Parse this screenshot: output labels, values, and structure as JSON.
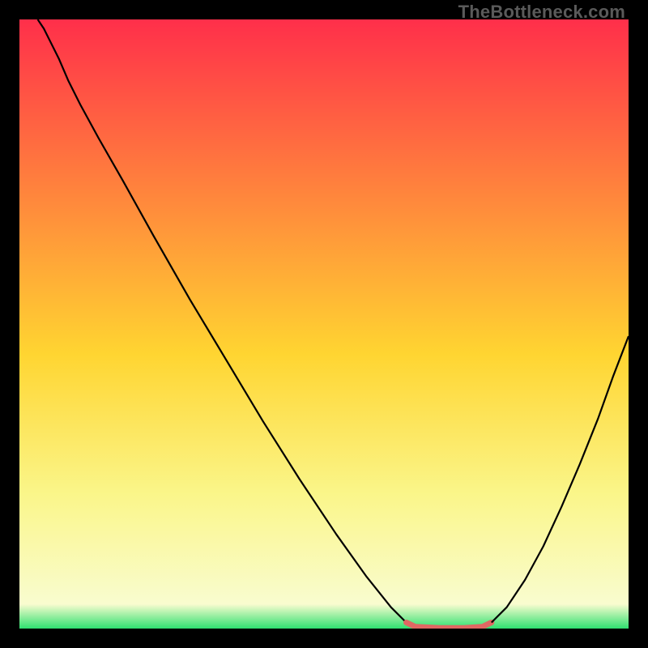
{
  "watermark": "TheBottleneck.com",
  "chart_data": {
    "type": "line",
    "title": "",
    "xlabel": "",
    "ylabel": "",
    "xlim": [
      0,
      100
    ],
    "ylim": [
      0,
      100
    ],
    "grid": false,
    "legend": false,
    "background_gradient": {
      "stops": [
        {
          "offset": 0.0,
          "color": "#ff2f4a"
        },
        {
          "offset": 0.25,
          "color": "#ff7a3e"
        },
        {
          "offset": 0.55,
          "color": "#ffd531"
        },
        {
          "offset": 0.78,
          "color": "#faf68a"
        },
        {
          "offset": 0.96,
          "color": "#f9fccf"
        },
        {
          "offset": 1.0,
          "color": "#2fe070"
        }
      ]
    },
    "series": [
      {
        "name": "left-curve",
        "color": "#000000",
        "width": 2.2,
        "x": [
          3.0,
          4.0,
          5.0,
          6.5,
          8.0,
          10.0,
          13.0,
          17.0,
          22.0,
          28.0,
          34.0,
          40.0,
          46.0,
          52.0,
          57.0,
          61.0,
          63.5
        ],
        "values": [
          100,
          98.5,
          96.5,
          93.5,
          90.0,
          86.0,
          80.5,
          73.5,
          64.5,
          54.0,
          44.0,
          34.0,
          24.5,
          15.5,
          8.5,
          3.5,
          1.0
        ]
      },
      {
        "name": "valley-flat",
        "color": "#e06763",
        "width": 7,
        "linecap": "round",
        "x": [
          63.5,
          65.0,
          69.0,
          73.0,
          76.0,
          77.5
        ],
        "values": [
          1.0,
          0.3,
          0.1,
          0.1,
          0.3,
          1.0
        ]
      },
      {
        "name": "right-curve",
        "color": "#000000",
        "width": 2.2,
        "x": [
          77.5,
          80.0,
          83.0,
          86.0,
          89.0,
          92.0,
          95.0,
          97.5,
          100.0
        ],
        "values": [
          1.0,
          3.5,
          8.0,
          13.5,
          20.0,
          27.0,
          34.5,
          41.5,
          48.0
        ]
      }
    ]
  }
}
